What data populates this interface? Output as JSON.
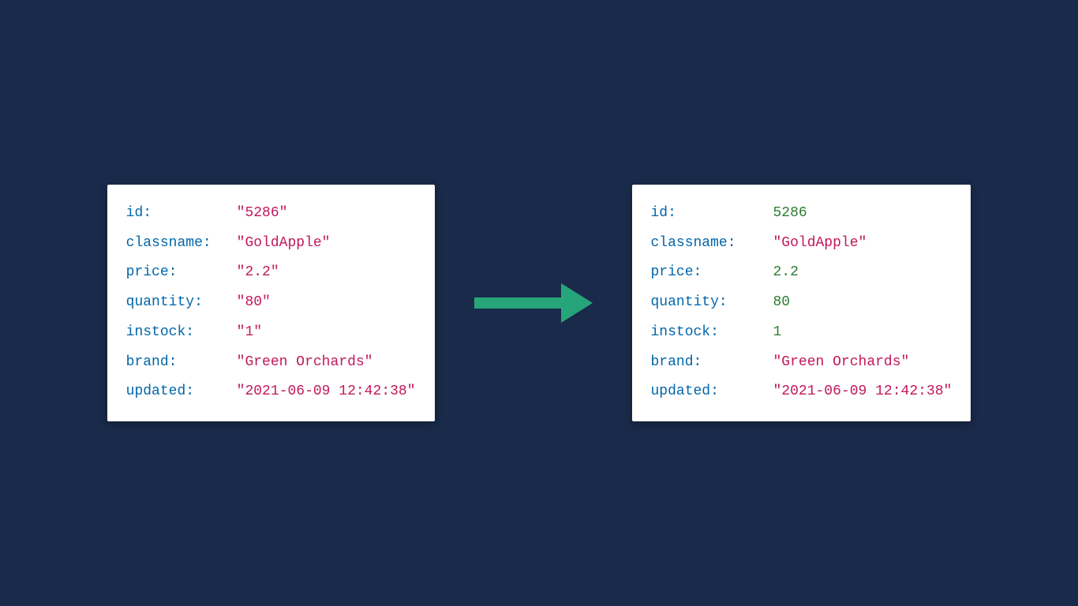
{
  "left": {
    "rows": [
      {
        "key": "id:",
        "value": "\"5286\"",
        "type": "string"
      },
      {
        "key": "classname:",
        "value": "\"GoldApple\"",
        "type": "string"
      },
      {
        "key": "price:",
        "value": "\"2.2\"",
        "type": "string"
      },
      {
        "key": "quantity:",
        "value": "\"80\"",
        "type": "string"
      },
      {
        "key": "instock:",
        "value": "\"1\"",
        "type": "string"
      },
      {
        "key": "brand:",
        "value": "\"Green Orchards\"",
        "type": "string"
      },
      {
        "key": "updated:",
        "value": "\"2021-06-09 12:42:38\"",
        "type": "string"
      }
    ]
  },
  "right": {
    "rows": [
      {
        "key": "id:",
        "value": "5286",
        "type": "number"
      },
      {
        "key": "classname:",
        "value": "\"GoldApple\"",
        "type": "string"
      },
      {
        "key": "price:",
        "value": "2.2",
        "type": "number"
      },
      {
        "key": "quantity:",
        "value": "80",
        "type": "number"
      },
      {
        "key": "instock:",
        "value": "1",
        "type": "number"
      },
      {
        "key": "brand:",
        "value": "\"Green Orchards\"",
        "type": "string"
      },
      {
        "key": "updated:",
        "value": "\"2021-06-09 12:42:38\"",
        "type": "string"
      }
    ]
  },
  "colors": {
    "arrow": "#27a57a"
  }
}
